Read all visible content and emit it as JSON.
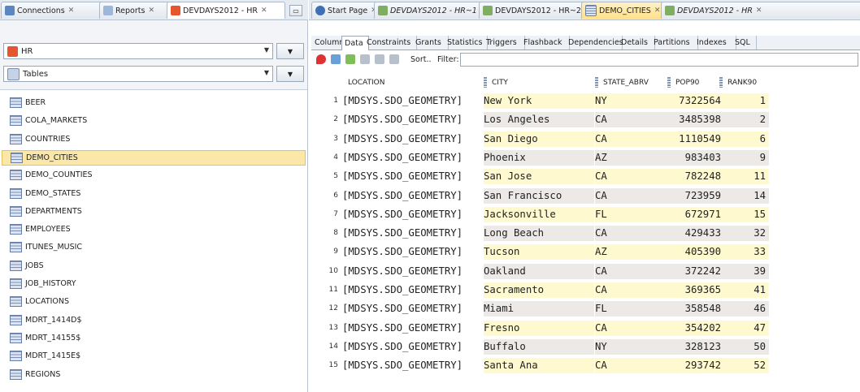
{
  "colors": {
    "selected_row": "#fbe8a9",
    "city_highlight": "#fff9cf",
    "alt_row": "#ece9e6"
  },
  "left_tabs": [
    {
      "label": "Connections",
      "icon": "connections-icon"
    },
    {
      "label": "Reports",
      "icon": "reports-icon"
    },
    {
      "label": "DEVDAYS2012 - HR",
      "icon": "database-icon"
    }
  ],
  "right_tabs": [
    {
      "label": "Start Page",
      "icon": "help-icon"
    },
    {
      "label": "DEVDAYS2012 - HR~1",
      "icon": "sql-worksheet-icon"
    },
    {
      "label": "DEVDAYS2012 - HR~2",
      "icon": "sql-worksheet-icon"
    },
    {
      "label": "DEMO_CITIES",
      "icon": "table-icon"
    },
    {
      "label": "DEVDAYS2012 - HR",
      "icon": "sql-worksheet-icon"
    }
  ],
  "connection_combo": {
    "value": "HR"
  },
  "object_type_combo": {
    "value": "Tables"
  },
  "tables": [
    "BEER",
    "COLA_MARKETS",
    "COUNTRIES",
    "DEMO_CITIES",
    "DEMO_COUNTIES",
    "DEMO_STATES",
    "DEPARTMENTS",
    "EMPLOYEES",
    "ITUNES_MUSIC",
    "JOBS",
    "JOB_HISTORY",
    "LOCATIONS",
    "MDRT_1414D$",
    "MDRT_14155$",
    "MDRT_1415E$",
    "REGIONS"
  ],
  "selected_table": "DEMO_CITIES",
  "subtabs": [
    "Columns",
    "Data",
    "Constraints",
    "Grants",
    "Statistics",
    "Triggers",
    "Flashback",
    "Dependencies",
    "Details",
    "Partitions",
    "Indexes",
    "SQL"
  ],
  "active_subtab": "Data",
  "toolbar": {
    "sort_label": "Sort..",
    "filter_label": "Filter:",
    "filter_value": ""
  },
  "grid": {
    "columns": [
      "LOCATION",
      "CITY",
      "STATE_ABRV",
      "POP90",
      "RANK90"
    ],
    "rows": [
      {
        "n": "1",
        "loc": "[MDSYS.SDO_GEOMETRY]",
        "city": "New York",
        "st": "NY",
        "pop": "7322564",
        "rank": "1"
      },
      {
        "n": "2",
        "loc": "[MDSYS.SDO_GEOMETRY]",
        "city": "Los Angeles",
        "st": "CA",
        "pop": "3485398",
        "rank": "2"
      },
      {
        "n": "3",
        "loc": "[MDSYS.SDO_GEOMETRY]",
        "city": "San Diego",
        "st": "CA",
        "pop": "1110549",
        "rank": "6"
      },
      {
        "n": "4",
        "loc": "[MDSYS.SDO_GEOMETRY]",
        "city": "Phoenix",
        "st": "AZ",
        "pop": "983403",
        "rank": "9"
      },
      {
        "n": "5",
        "loc": "[MDSYS.SDO_GEOMETRY]",
        "city": "San Jose",
        "st": "CA",
        "pop": "782248",
        "rank": "11"
      },
      {
        "n": "6",
        "loc": "[MDSYS.SDO_GEOMETRY]",
        "city": "San Francisco",
        "st": "CA",
        "pop": "723959",
        "rank": "14"
      },
      {
        "n": "7",
        "loc": "[MDSYS.SDO_GEOMETRY]",
        "city": "Jacksonville",
        "st": "FL",
        "pop": "672971",
        "rank": "15"
      },
      {
        "n": "8",
        "loc": "[MDSYS.SDO_GEOMETRY]",
        "city": "Long Beach",
        "st": "CA",
        "pop": "429433",
        "rank": "32"
      },
      {
        "n": "9",
        "loc": "[MDSYS.SDO_GEOMETRY]",
        "city": "Tucson",
        "st": "AZ",
        "pop": "405390",
        "rank": "33"
      },
      {
        "n": "10",
        "loc": "[MDSYS.SDO_GEOMETRY]",
        "city": "Oakland",
        "st": "CA",
        "pop": "372242",
        "rank": "39"
      },
      {
        "n": "11",
        "loc": "[MDSYS.SDO_GEOMETRY]",
        "city": "Sacramento",
        "st": "CA",
        "pop": "369365",
        "rank": "41"
      },
      {
        "n": "12",
        "loc": "[MDSYS.SDO_GEOMETRY]",
        "city": "Miami",
        "st": "FL",
        "pop": "358548",
        "rank": "46"
      },
      {
        "n": "13",
        "loc": "[MDSYS.SDO_GEOMETRY]",
        "city": "Fresno",
        "st": "CA",
        "pop": "354202",
        "rank": "47"
      },
      {
        "n": "14",
        "loc": "[MDSYS.SDO_GEOMETRY]",
        "city": "Buffalo",
        "st": "NY",
        "pop": "328123",
        "rank": "50"
      },
      {
        "n": "15",
        "loc": "[MDSYS.SDO_GEOMETRY]",
        "city": "Santa Ana",
        "st": "CA",
        "pop": "293742",
        "rank": "52"
      }
    ]
  }
}
